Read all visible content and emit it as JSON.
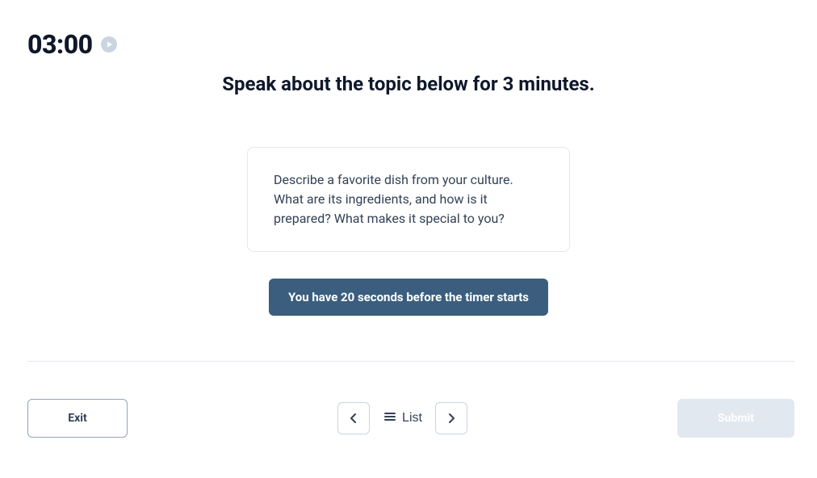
{
  "timer": {
    "value": "03:00"
  },
  "instruction": "Speak about the topic below for 3 minutes.",
  "prompt": "Describe a favorite dish from your culture. What are its ingredients, and how is it prepared? What makes it special to you?",
  "countdown_message": "You have 20 seconds before the timer starts",
  "footer": {
    "exit_label": "Exit",
    "list_label": "List",
    "submit_label": "Submit"
  }
}
